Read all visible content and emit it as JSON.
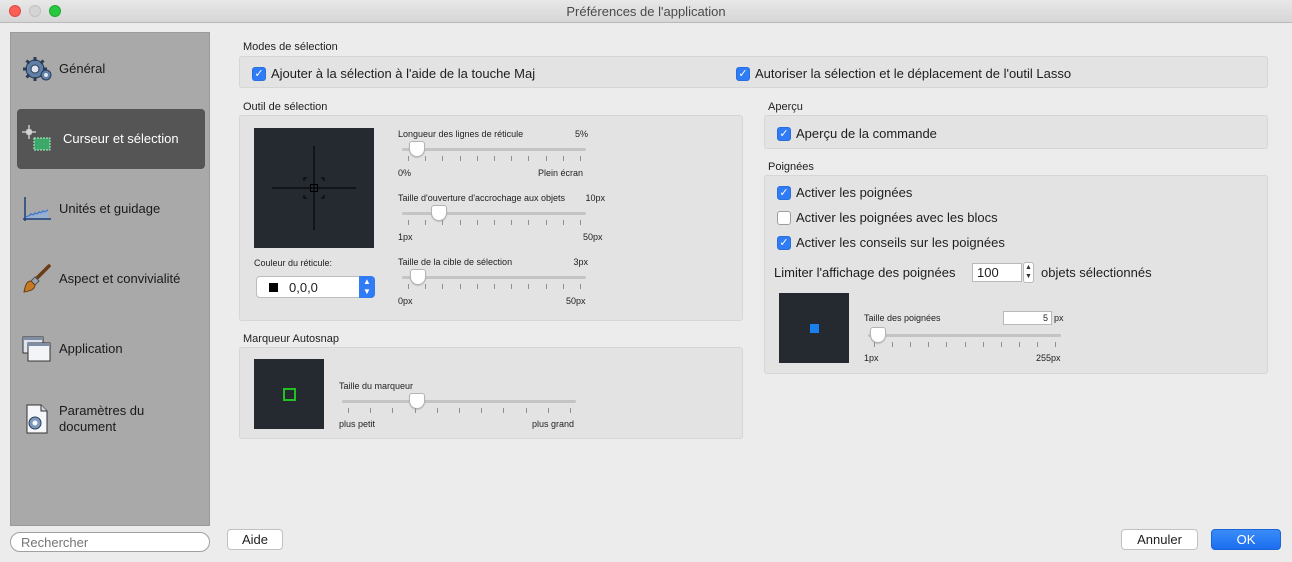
{
  "window": {
    "title": "Préférences de l'application"
  },
  "sidebar": {
    "items": [
      {
        "label": "Général",
        "icon": "gear-icon"
      },
      {
        "label": "Curseur et sélection",
        "icon": "cursor-selection-icon",
        "selected": true
      },
      {
        "label": "Unités et guidage",
        "icon": "units-chart-icon"
      },
      {
        "label": "Aspect et convivialité",
        "icon": "paintbrush-icon"
      },
      {
        "label": "Application",
        "icon": "windows-stack-icon"
      },
      {
        "label": "Paramètres du document",
        "icon": "document-gear-icon"
      }
    ],
    "search_placeholder": "Rechercher"
  },
  "modes": {
    "title": "Modes de sélection",
    "shift_add": {
      "label": "Ajouter à la sélection à l'aide de la touche Maj",
      "checked": true
    },
    "lasso": {
      "label": "Autoriser la sélection et le déplacement de l'outil Lasso",
      "checked": true
    }
  },
  "selection_tool": {
    "title": "Outil de sélection",
    "reticle_color_label": "Couleur du réticule:",
    "reticle_color_value": "0,0,0",
    "crosshair": {
      "title": "Longueur des lignes de réticule",
      "value": "5%",
      "min": "0%",
      "max": "Plein écran",
      "fraction": 0.05
    },
    "aperture": {
      "title": "Taille d'ouverture d'accrochage aux objets",
      "value": "10px",
      "min": "1px",
      "max": "50px",
      "fraction": 0.18
    },
    "pickbox": {
      "title": "Taille de la cible de sélection",
      "value": "3px",
      "min": "0px",
      "max": "50px",
      "fraction": 0.06
    }
  },
  "autosnap": {
    "title": "Marqueur Autosnap",
    "slider": {
      "title": "Taille du marqueur",
      "min": "plus petit",
      "max": "plus grand",
      "fraction": 0.31
    }
  },
  "preview": {
    "title": "Aperçu",
    "command_preview": {
      "label": "Aperçu de la commande",
      "checked": true
    }
  },
  "grips": {
    "title": "Poignées",
    "enable": {
      "label": "Activer les poignées",
      "checked": true
    },
    "blocks": {
      "label": "Activer les poignées avec les blocs",
      "checked": false
    },
    "tips": {
      "label": "Activer les conseils sur les poignées",
      "checked": true
    },
    "limit_label_before": "Limiter l'affichage des poignées",
    "limit_value": "100",
    "limit_label_after": "objets sélectionnés",
    "size": {
      "title": "Taille des poignées",
      "value": "5",
      "unit": "px",
      "min": "1px",
      "max": "255px",
      "fraction": 0.02
    }
  },
  "buttons": {
    "help": "Aide",
    "cancel": "Annuler",
    "ok": "OK"
  },
  "colors": {
    "accent": "#2f7cf6",
    "preview_bg": "#252a31",
    "grip": "#1b7ff0",
    "autosnap_marker": "#22c022"
  }
}
